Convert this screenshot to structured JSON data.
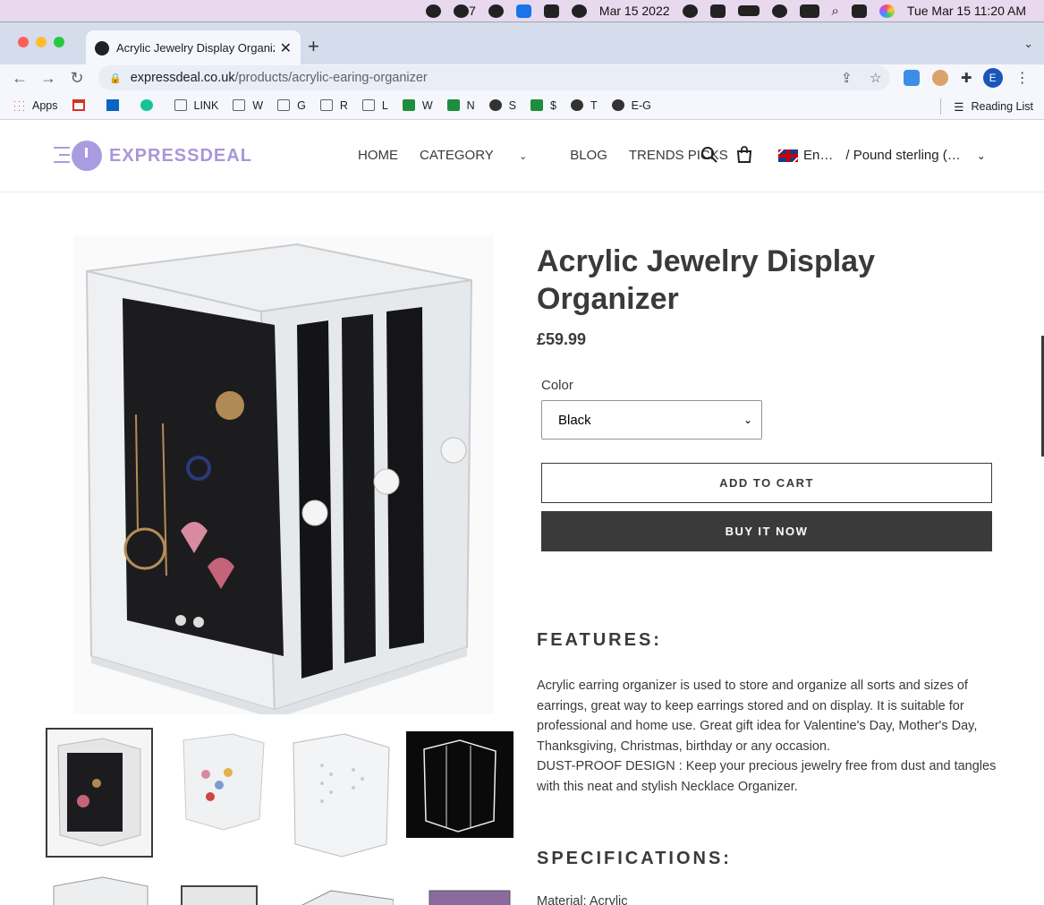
{
  "menubar": {
    "date_short": "Mar 15 2022",
    "clock": "Tue Mar 15  11:20 AM",
    "notification_count": "7"
  },
  "browser": {
    "tab_title": "Acrylic Jewelry Display Organizer",
    "url_host": "expressdeal.co.uk",
    "url_path": "/products/acrylic-earing-organizer",
    "profile_initial": "E",
    "bookmarks": [
      "Apps",
      "LINK",
      "W",
      "G",
      "R",
      "L",
      "W",
      "N",
      "S",
      "$",
      "T",
      "E-G"
    ],
    "reading_list": "Reading List"
  },
  "site": {
    "logo_text": "EXPRESSDEAL",
    "nav": [
      "HOME",
      "CATEGORY",
      "BLOG",
      "TRENDS PICKS"
    ],
    "language": "En…",
    "currency": "/ Pound sterling (…"
  },
  "product": {
    "title": "Acrylic Jewelry Display Organizer",
    "price": "£59.99",
    "color_label": "Color",
    "color_value": "Black",
    "add_to_cart": "ADD TO CART",
    "buy_now": "BUY IT NOW",
    "features_heading": "FEATURES:",
    "description_1": "Acrylic earring organizer is used to store and organize all sorts and sizes of earrings, great way to keep earrings stored and on display. It is suitable for professional and home use. Great gift idea for Valentine's Day, Mother's Day, Thanksgiving, Christmas, birthday or any occasion.",
    "description_2": "DUST-PROOF DESIGN : Keep your precious jewelry free from dust and tangles with this neat and stylish Necklace Organizer.",
    "specs_heading": "SPECIFICATIONS:",
    "spec_1": "Material: Acrylic"
  }
}
